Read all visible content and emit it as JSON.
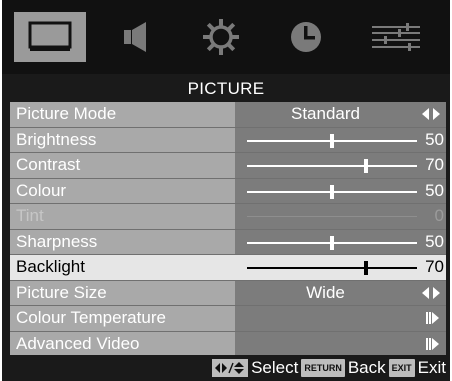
{
  "menu_tabs": [
    {
      "icon": "tv-screen-icon",
      "active": true
    },
    {
      "icon": "speaker-icon",
      "active": false
    },
    {
      "icon": "gear-icon",
      "active": false
    },
    {
      "icon": "clock-icon",
      "active": false
    },
    {
      "icon": "sliders-icon",
      "active": false
    }
  ],
  "section_title": "PICTURE",
  "rows": [
    {
      "label": "Picture Mode",
      "value": "Standard"
    },
    {
      "label": "Brightness",
      "level": 50,
      "number": "50"
    },
    {
      "label": "Contrast",
      "level": 70,
      "number": "70"
    },
    {
      "label": "Colour",
      "level": 50,
      "number": "50"
    },
    {
      "label": "Tint",
      "number": "0"
    },
    {
      "label": "Sharpness",
      "level": 50,
      "number": "50"
    },
    {
      "label": "Backlight",
      "level": 70,
      "number": "70"
    },
    {
      "label": "Picture Size",
      "value": "Wide"
    },
    {
      "label": "Colour Temperature"
    },
    {
      "label": "Advanced Video"
    }
  ],
  "footer": {
    "select_label": "Select",
    "return_key": "RETURN",
    "back_label": "Back",
    "exit_key": "EXIT",
    "exit_label": "Exit"
  },
  "colors": {
    "osd_background": "#1a1a1a",
    "label_cell": "#a9a9a9",
    "value_cell": "#7c7c7c",
    "selected_row": "#e6e6e6",
    "active_tab": "#9a9a9a"
  }
}
